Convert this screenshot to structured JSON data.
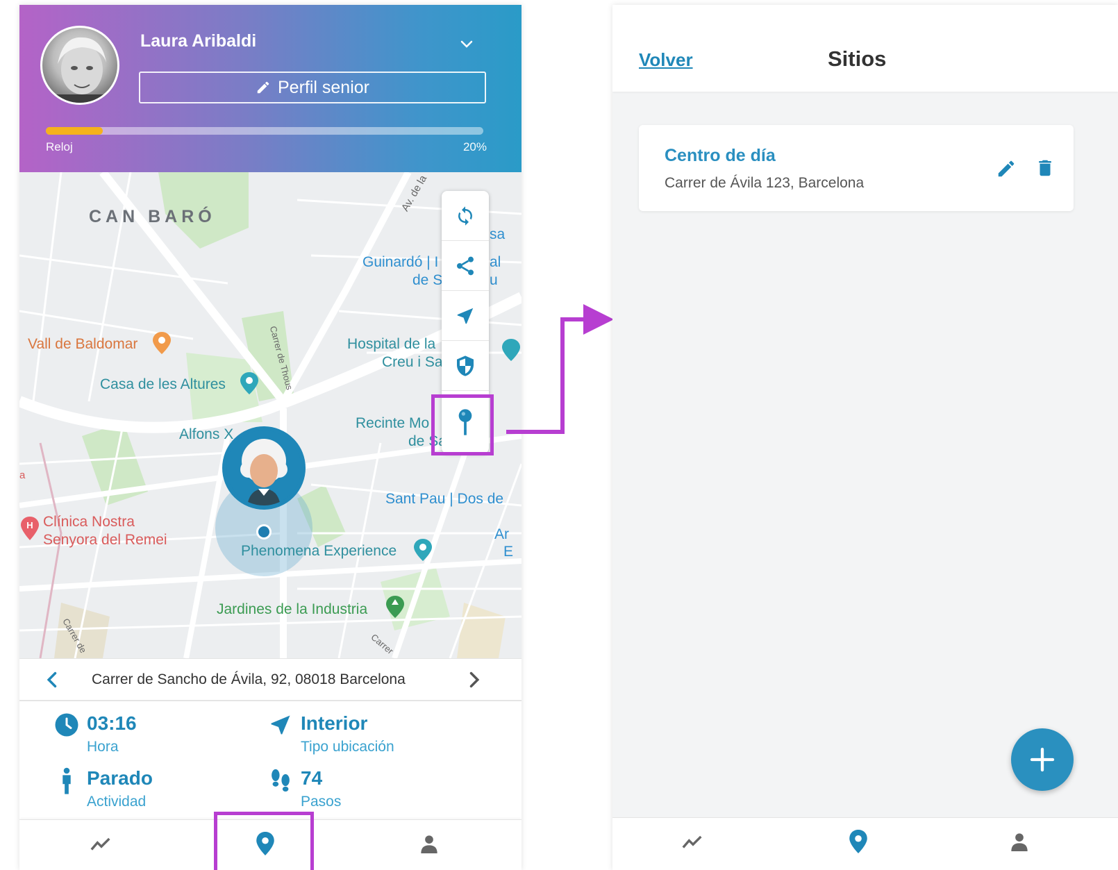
{
  "profile": {
    "name": "Laura Aribaldi",
    "profile_button_label": "Perfil senior",
    "device_label": "Reloj",
    "battery_text": "20%",
    "battery_fraction": 0.13
  },
  "map": {
    "labels": {
      "can_baro": "CAN BARÓ",
      "av_de_la": "Av. de la",
      "guinardo_1": "Guinardó | I",
      "guinardo_2": "de S",
      "hospital_1": "Hospital de la",
      "hospital_2": "Creu i Sa",
      "vall": "Vall de Baldomar",
      "casa": "Casa de les Altures",
      "alfons": "Alfons X",
      "recinte_1": "Recinte Mo",
      "recinte_2": "de Sa",
      "sant_pau": "Sant Pau | Dos de",
      "clinica_1": "Clínica Nostra",
      "clinica_2": "Senyora del Remei",
      "phenomena": "Phenomena Experience",
      "jardines": "Jardines de la Industria",
      "street_thous": "Carrer de Thous",
      "street_carrer": "Carrer",
      "street_carrer2": "Carrer de",
      "frag_sa": "sa",
      "frag_al": "al",
      "frag_u": "u",
      "frag_ar": "Ar",
      "frag_e": "E",
      "frag_a": "a"
    },
    "toolbar": [
      "refresh-icon",
      "share-icon",
      "navigation-icon",
      "shield-icon",
      "pin-icon"
    ]
  },
  "location": {
    "address": "Carrer de Sancho de Ávila, 92, 08018 Barcelona"
  },
  "stats": {
    "time": {
      "value": "03:16",
      "label": "Hora"
    },
    "location_type": {
      "value": "Interior",
      "label": "Tipo ubicación"
    },
    "activity": {
      "value": "Parado",
      "label": "Actividad"
    },
    "steps": {
      "value": "74",
      "label": "Pasos"
    }
  },
  "sites_page": {
    "back_label": "Volver",
    "title": "Sitios",
    "sites": [
      {
        "name": "Centro de día",
        "address": "Carrer de Ávila 123, Barcelona"
      }
    ]
  },
  "colors": {
    "accent": "#1f87b8",
    "highlight": "#b73ed1",
    "battery": "#f5b21c"
  }
}
